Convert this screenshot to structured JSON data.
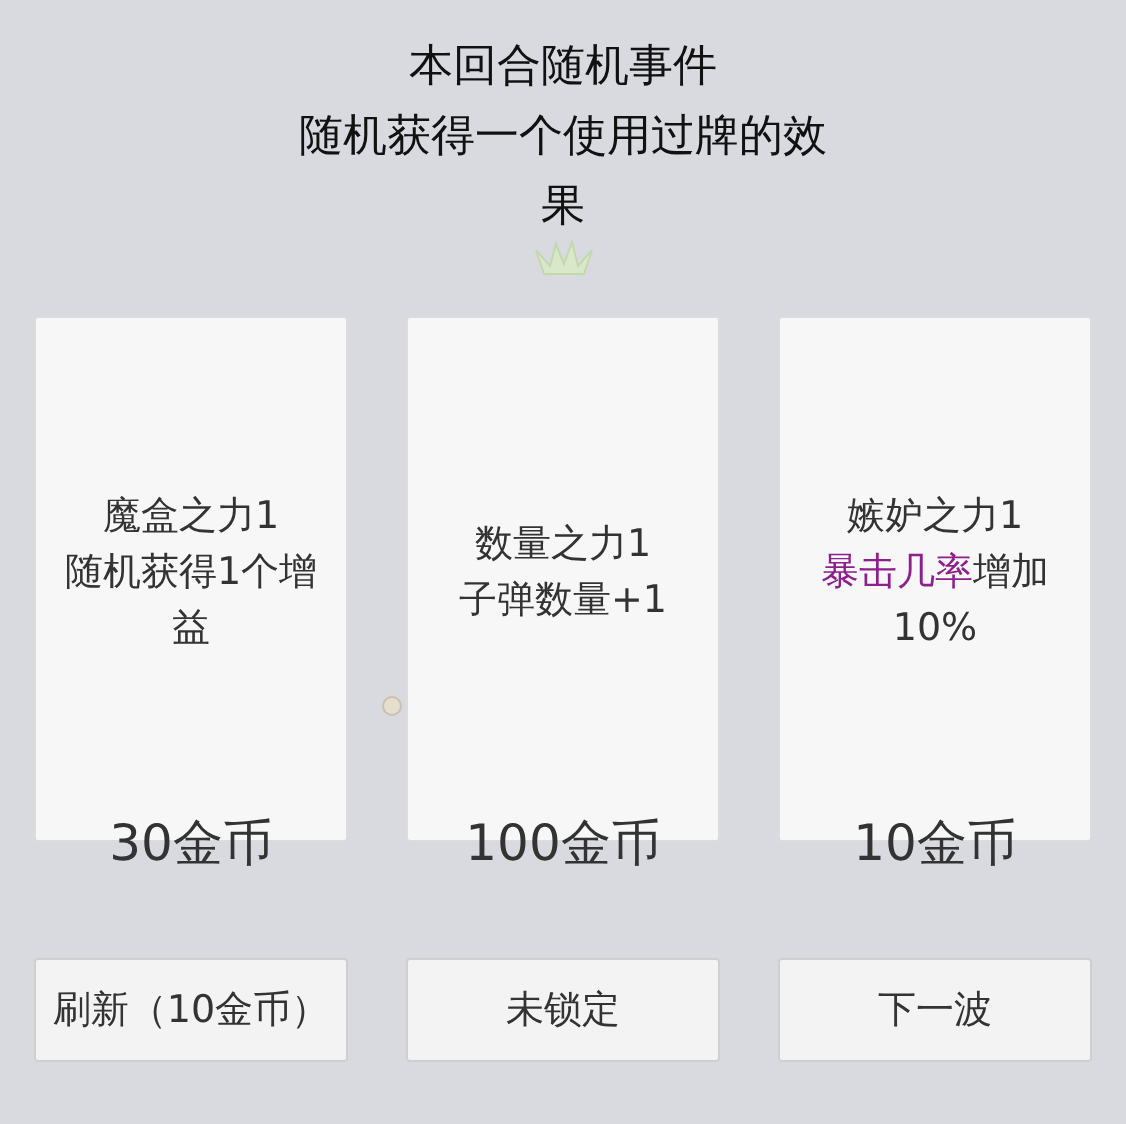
{
  "title_lines": [
    "本回合随机事件",
    "随机获得一个使用过牌的效果"
  ],
  "cards": [
    {
      "name": "魔盒之力1",
      "effect": [
        {
          "text": "随机获得1个增益"
        }
      ],
      "price": "30金币"
    },
    {
      "name": "数量之力1",
      "effect": [
        {
          "text": "子弹数量+1"
        }
      ],
      "price": "100金币"
    },
    {
      "name": "嫉妒之力1",
      "effect": [
        {
          "text": "暴击几率",
          "color": "#8e1f8e"
        },
        {
          "text": "增加10%"
        }
      ],
      "price": "10金币"
    }
  ],
  "buttons": [
    "刷新（10金币）",
    "未锁定",
    "下一波"
  ]
}
